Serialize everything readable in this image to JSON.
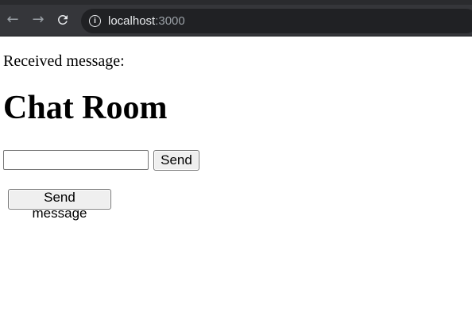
{
  "browser": {
    "url_host": "localhost",
    "url_port": ":3000",
    "back_icon": "arrow-left-icon",
    "forward_icon": "arrow-right-icon",
    "reload_icon": "reload-icon",
    "info_icon": "info-icon"
  },
  "page": {
    "received_label": "Received message:",
    "title": "Chat Room",
    "input_value": "",
    "send_label": "Send",
    "send_message_label": "Send message"
  },
  "colors": {
    "toolbar_bg": "#35363a",
    "omnibox_bg": "#202124",
    "page_bg": "#ffffff"
  }
}
